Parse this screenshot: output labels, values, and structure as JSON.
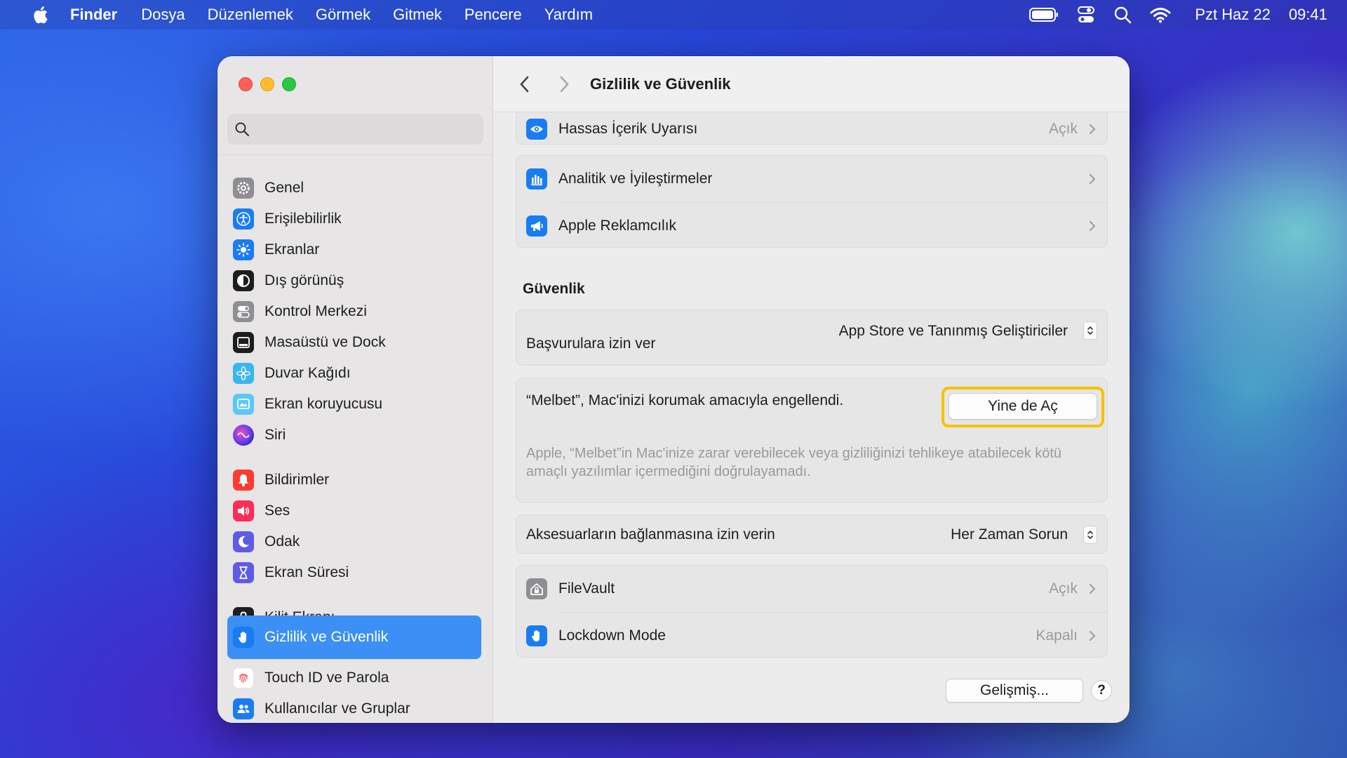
{
  "menubar": {
    "app_name": "Finder",
    "items": [
      "Dosya",
      "Düzenlemek",
      "Görmek",
      "Gitmek",
      "Pencere",
      "Yardım"
    ],
    "date": "Pzt Haz 22",
    "time": "09:41"
  },
  "sidebar": {
    "search_placeholder": "",
    "items": [
      {
        "label": "Genel",
        "icon": "gear-icon",
        "color": "#8e8e93"
      },
      {
        "label": "Erişilebilirlik",
        "icon": "accessibility-icon",
        "color": "#1a7cf3"
      },
      {
        "label": "Ekranlar",
        "icon": "sun-icon",
        "color": "#1a7cf3"
      },
      {
        "label": "Dış görünüş",
        "icon": "appearance-icon",
        "color": "#1d1d1f"
      },
      {
        "label": "Kontrol Merkezi",
        "icon": "toggles-icon",
        "color": "#8e8e93"
      },
      {
        "label": "Masaüstü ve Dock",
        "icon": "dock-icon",
        "color": "#1d1d1f"
      },
      {
        "label": "Duvar Kağıdı",
        "icon": "flower-icon",
        "color": "#38b6f0"
      },
      {
        "label": "Ekran koruyucusu",
        "icon": "screensaver-icon",
        "color": "#5ac8fa"
      },
      {
        "label": "Siri",
        "icon": "siri-icon",
        "color": "#3a1e6e"
      },
      {
        "label": "Bildirimler",
        "icon": "bell-icon",
        "color": "#ff3b30"
      },
      {
        "label": "Ses",
        "icon": "speaker-icon",
        "color": "#ff2d55"
      },
      {
        "label": "Odak",
        "icon": "moon-icon",
        "color": "#5e5ce6"
      },
      {
        "label": "Ekran Süresi",
        "icon": "hourglass-icon",
        "color": "#5e5ce6"
      },
      {
        "label": "Kilit Ekranı",
        "icon": "lock-icon",
        "color": "#1d1d1f"
      },
      {
        "label": "Gizlilik ve Güvenlik",
        "icon": "hand-icon",
        "color": "#1a7cf3"
      },
      {
        "label": "Touch ID ve Parola",
        "icon": "fingerprint-icon",
        "color": "#ff6b6b"
      },
      {
        "label": "Kullanıcılar ve Gruplar",
        "icon": "users-icon",
        "color": "#1a7cf3"
      }
    ]
  },
  "main": {
    "title": "Gizlilik ve Güvenlik",
    "privacy_rows": [
      {
        "label": "Hassas İçerik Uyarısı",
        "value": "Açık",
        "icon": "eye-icon",
        "color": "#1a7cf3"
      },
      {
        "label": "Analitik ve İyileştirmeler",
        "value": "",
        "icon": "chart-icon",
        "color": "#1a7cf3"
      },
      {
        "label": "Apple Reklamcılık",
        "value": "",
        "icon": "megaphone-icon",
        "color": "#1a7cf3"
      }
    ],
    "security_title": "Güvenlik",
    "allow_apps": {
      "label": "Başvurulara izin ver",
      "value": "App Store ve Tanınmış Geliştiriciler"
    },
    "blocked": {
      "message": "“Melbet”, Mac'inizi korumak amacıyla engellendi.",
      "button": "Yine de Aç",
      "description": "Apple, “Melbet”in Mac'inize zarar verebilecek veya gizliliğinizi tehlikeye atabilecek kötü amaçlı yazılımlar içermediğini doğrulayamadı."
    },
    "accessories": {
      "label": "Aksesuarların bağlanmasına izin verin",
      "value": "Her Zaman Sorun"
    },
    "security_rows": [
      {
        "label": "FileVault",
        "value": "Açık",
        "icon": "house-lock-icon",
        "color": "#8e8e93"
      },
      {
        "label": "Lockdown Mode",
        "value": "Kapalı",
        "icon": "hand-icon",
        "color": "#1a7cf3"
      }
    ],
    "advanced_button": "Gelişmiş...",
    "help_button": "?"
  },
  "colors": {
    "accent": "#3b8ff5",
    "highlight": "#f7c200"
  }
}
